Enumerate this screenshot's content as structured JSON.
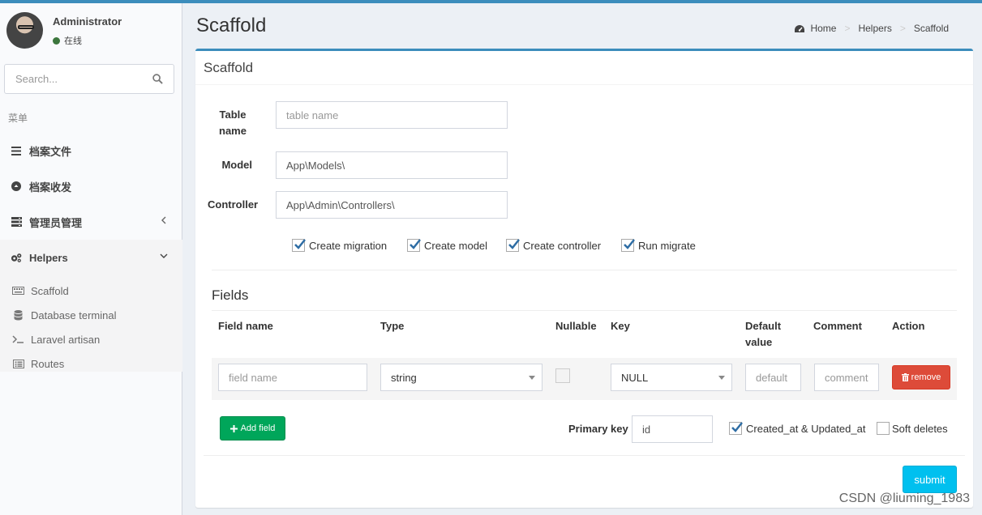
{
  "user": {
    "name": "Administrator",
    "status": "在线"
  },
  "search": {
    "placeholder": "Search..."
  },
  "menu": {
    "header": "菜单",
    "items": [
      {
        "label": "档案文件",
        "icon": "bars-icon"
      },
      {
        "label": "档案收发",
        "icon": "circle-up-icon"
      },
      {
        "label": "管理员管理",
        "icon": "server-icon"
      },
      {
        "label": "Helpers",
        "icon": "cogs-icon"
      }
    ],
    "sub_items": [
      {
        "label": "Scaffold",
        "icon": "keyboard-icon"
      },
      {
        "label": "Database terminal",
        "icon": "database-icon"
      },
      {
        "label": "Laravel artisan",
        "icon": "terminal-icon"
      },
      {
        "label": "Routes",
        "icon": "list-alt-icon"
      }
    ]
  },
  "page": {
    "title": "Scaffold"
  },
  "breadcrumb": {
    "home": "Home",
    "helpers": "Helpers",
    "current": "Scaffold"
  },
  "form": {
    "box_title": "Scaffold",
    "table_name_label": "Table name",
    "table_name_placeholder": "table name",
    "model_label": "Model",
    "model_value": "App\\Models\\",
    "controller_label": "Controller",
    "controller_value": "App\\Admin\\Controllers\\",
    "checks": [
      {
        "label": "Create migration",
        "checked": true
      },
      {
        "label": "Create model",
        "checked": true
      },
      {
        "label": "Create controller",
        "checked": true
      },
      {
        "label": "Run migrate",
        "checked": true
      }
    ]
  },
  "fields": {
    "title": "Fields",
    "headers": [
      "Field name",
      "Type",
      "Nullable",
      "Key",
      "Default value",
      "Comment",
      "Action"
    ],
    "row": {
      "field_name_placeholder": "field name",
      "type": "string",
      "key": "NULL",
      "default_placeholder": "default",
      "comment_placeholder": "comment",
      "remove_label": "remove"
    },
    "add_label": "Add field",
    "primary_key_label": "Primary key",
    "primary_key_value": "id",
    "timestamps_label": "Created_at & Updated_at",
    "soft_deletes_label": "Soft deletes"
  },
  "submit_label": "submit",
  "watermark": "CSDN @liuming_1983",
  "colors": {
    "primary": "#3c8dbc",
    "danger": "#dd4b39",
    "success": "#00a65a",
    "info": "#00c0ef"
  }
}
